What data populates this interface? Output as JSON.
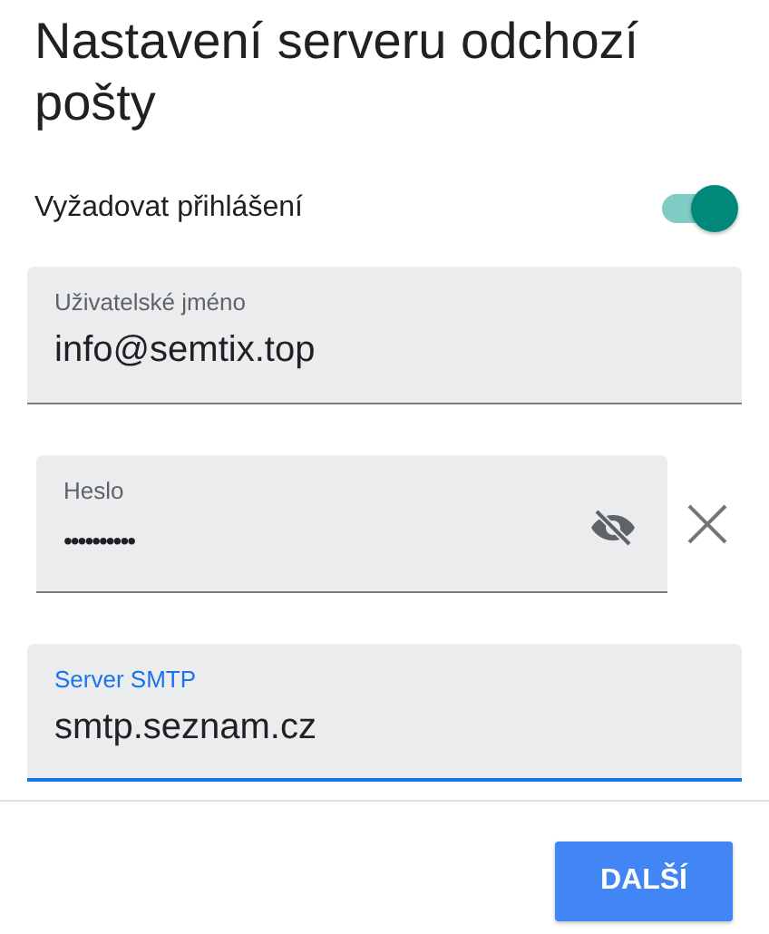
{
  "title": "Nastavení serveru odchozí pošty",
  "auth_toggle": {
    "label": "Vyžadovat přihlášení",
    "on": true
  },
  "fields": [
    {
      "kind": "text",
      "label": "Uživatelské jméno",
      "value": "info@semtix.top",
      "focused": false
    },
    {
      "kind": "password",
      "label": "Heslo",
      "value": "••••••••••",
      "focused": false
    },
    {
      "kind": "text",
      "label": "Server SMTP",
      "value": "smtp.seznam.cz",
      "focused": true
    }
  ],
  "next_button": "DALŠÍ"
}
